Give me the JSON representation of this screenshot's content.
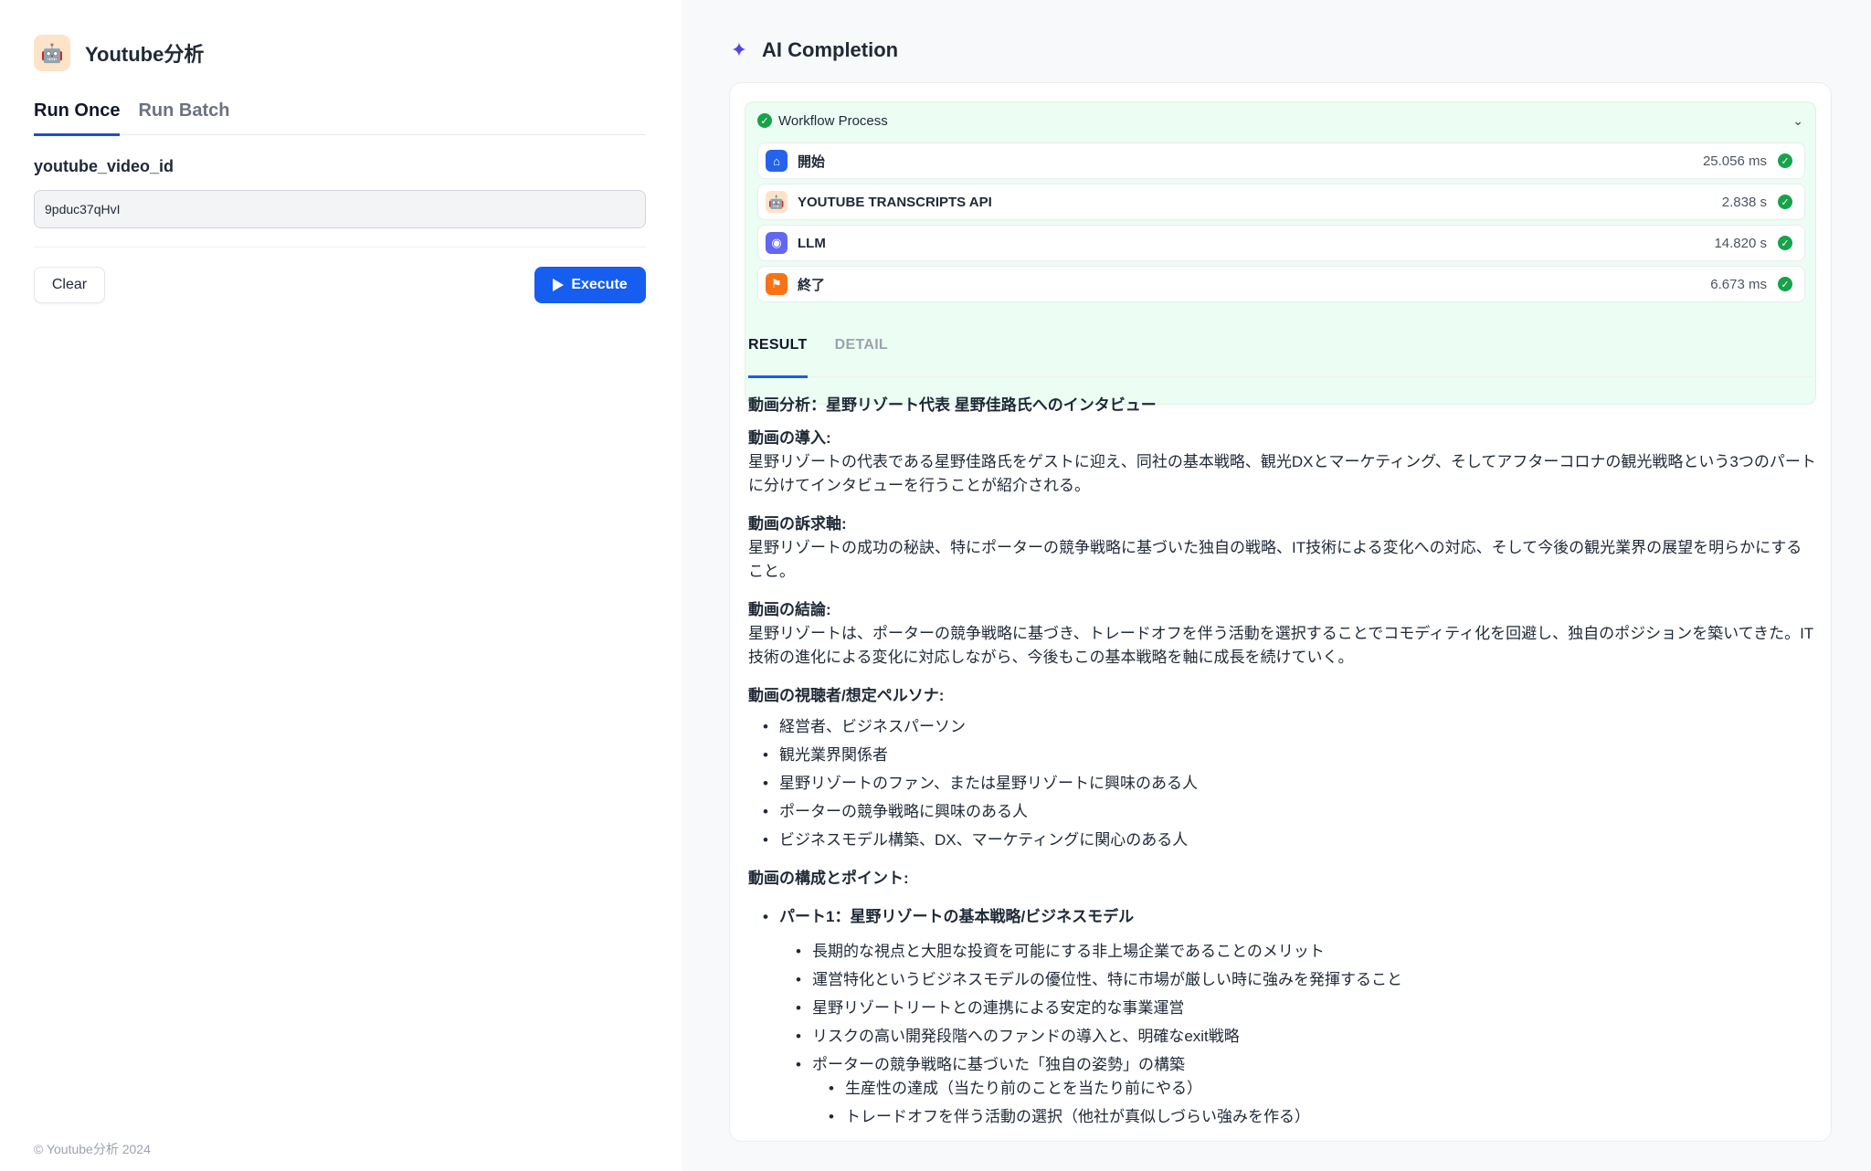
{
  "app": {
    "title": "Youtube分析",
    "icon": "robot-icon",
    "footer": "© Youtube分析 2024"
  },
  "tabs": [
    {
      "label": "Run Once",
      "active": true
    },
    {
      "label": "Run Batch",
      "active": false
    }
  ],
  "form": {
    "field_label": "youtube_video_id",
    "field_value": "9pduc37qHvI",
    "clear_label": "Clear",
    "execute_label": "Execute"
  },
  "completion": {
    "title": "AI Completion",
    "workflow": {
      "title": "Workflow Process",
      "status_color": "#16a34a",
      "steps": [
        {
          "name": "開始",
          "time": "25.056 ms",
          "icon": "home-icon",
          "color": "#2563eb"
        },
        {
          "name": "YOUTUBE TRANSCRIPTS API",
          "time": "2.838 s",
          "icon": "robot-icon",
          "color": "#fde3c8"
        },
        {
          "name": "LLM",
          "time": "14.820 s",
          "icon": "llm-icon",
          "color": "#6366f1"
        },
        {
          "name": "終了",
          "time": "6.673 ms",
          "icon": "end-flag-icon",
          "color": "#f97316"
        }
      ]
    },
    "result_tabs": [
      {
        "label": "RESULT",
        "active": true
      },
      {
        "label": "DETAIL",
        "active": false
      }
    ],
    "result": {
      "heading": "動画分析：星野リゾート代表 星野佳路氏へのインタビュー",
      "intro_title": "動画の導入:",
      "intro_body": "星野リゾートの代表である星野佳路氏をゲストに迎え、同社の基本戦略、観光DXとマーケティング、そしてアフターコロナの観光戦略という3つのパートに分けてインタビューを行うことが紹介される。",
      "appeal_title": "動画の訴求軸:",
      "appeal_body": "星野リゾートの成功の秘訣、特にポーターの競争戦略に基づいた独自の戦略、IT技術による変化への対応、そして今後の観光業界の展望を明らかにすること。",
      "conclusion_title": "動画の結論:",
      "conclusion_body": "星野リゾートは、ポーターの競争戦略に基づき、トレードオフを伴う活動を選択することでコモディティ化を回避し、独自のポジションを築いてきた。IT技術の進化による変化に対応しながら、今後もこの基本戦略を軸に成長を続けていく。",
      "persona_title": "動画の視聴者/想定ペルソナ:",
      "personas": [
        "経営者、ビジネスパーソン",
        "観光業界関係者",
        "星野リゾートのファン、または星野リゾートに興味のある人",
        "ポーターの競争戦略に興味のある人",
        "ビジネスモデル構築、DX、マーケティングに関心のある人"
      ],
      "structure_title": "動画の構成とポイント:",
      "part1_title": "パート1：星野リゾートの基本戦略/ビジネスモデル",
      "part1_points": [
        "長期的な視点と大胆な投資を可能にする非上場企業であることのメリット",
        "運営特化というビジネスモデルの優位性、特に市場が厳しい時に強みを発揮すること",
        "星野リゾートリートとの連携による安定的な事業運営",
        "リスクの高い開発段階へのファンドの導入と、明確なexit戦略",
        "ポーターの競争戦略に基づいた「独自の姿勢」の構築"
      ],
      "part1_sub": [
        "生産性の達成（当たり前のことを当たり前にやる）",
        "トレードオフを伴う活動の選択（他社が真似しづらい強みを作る）"
      ]
    }
  }
}
